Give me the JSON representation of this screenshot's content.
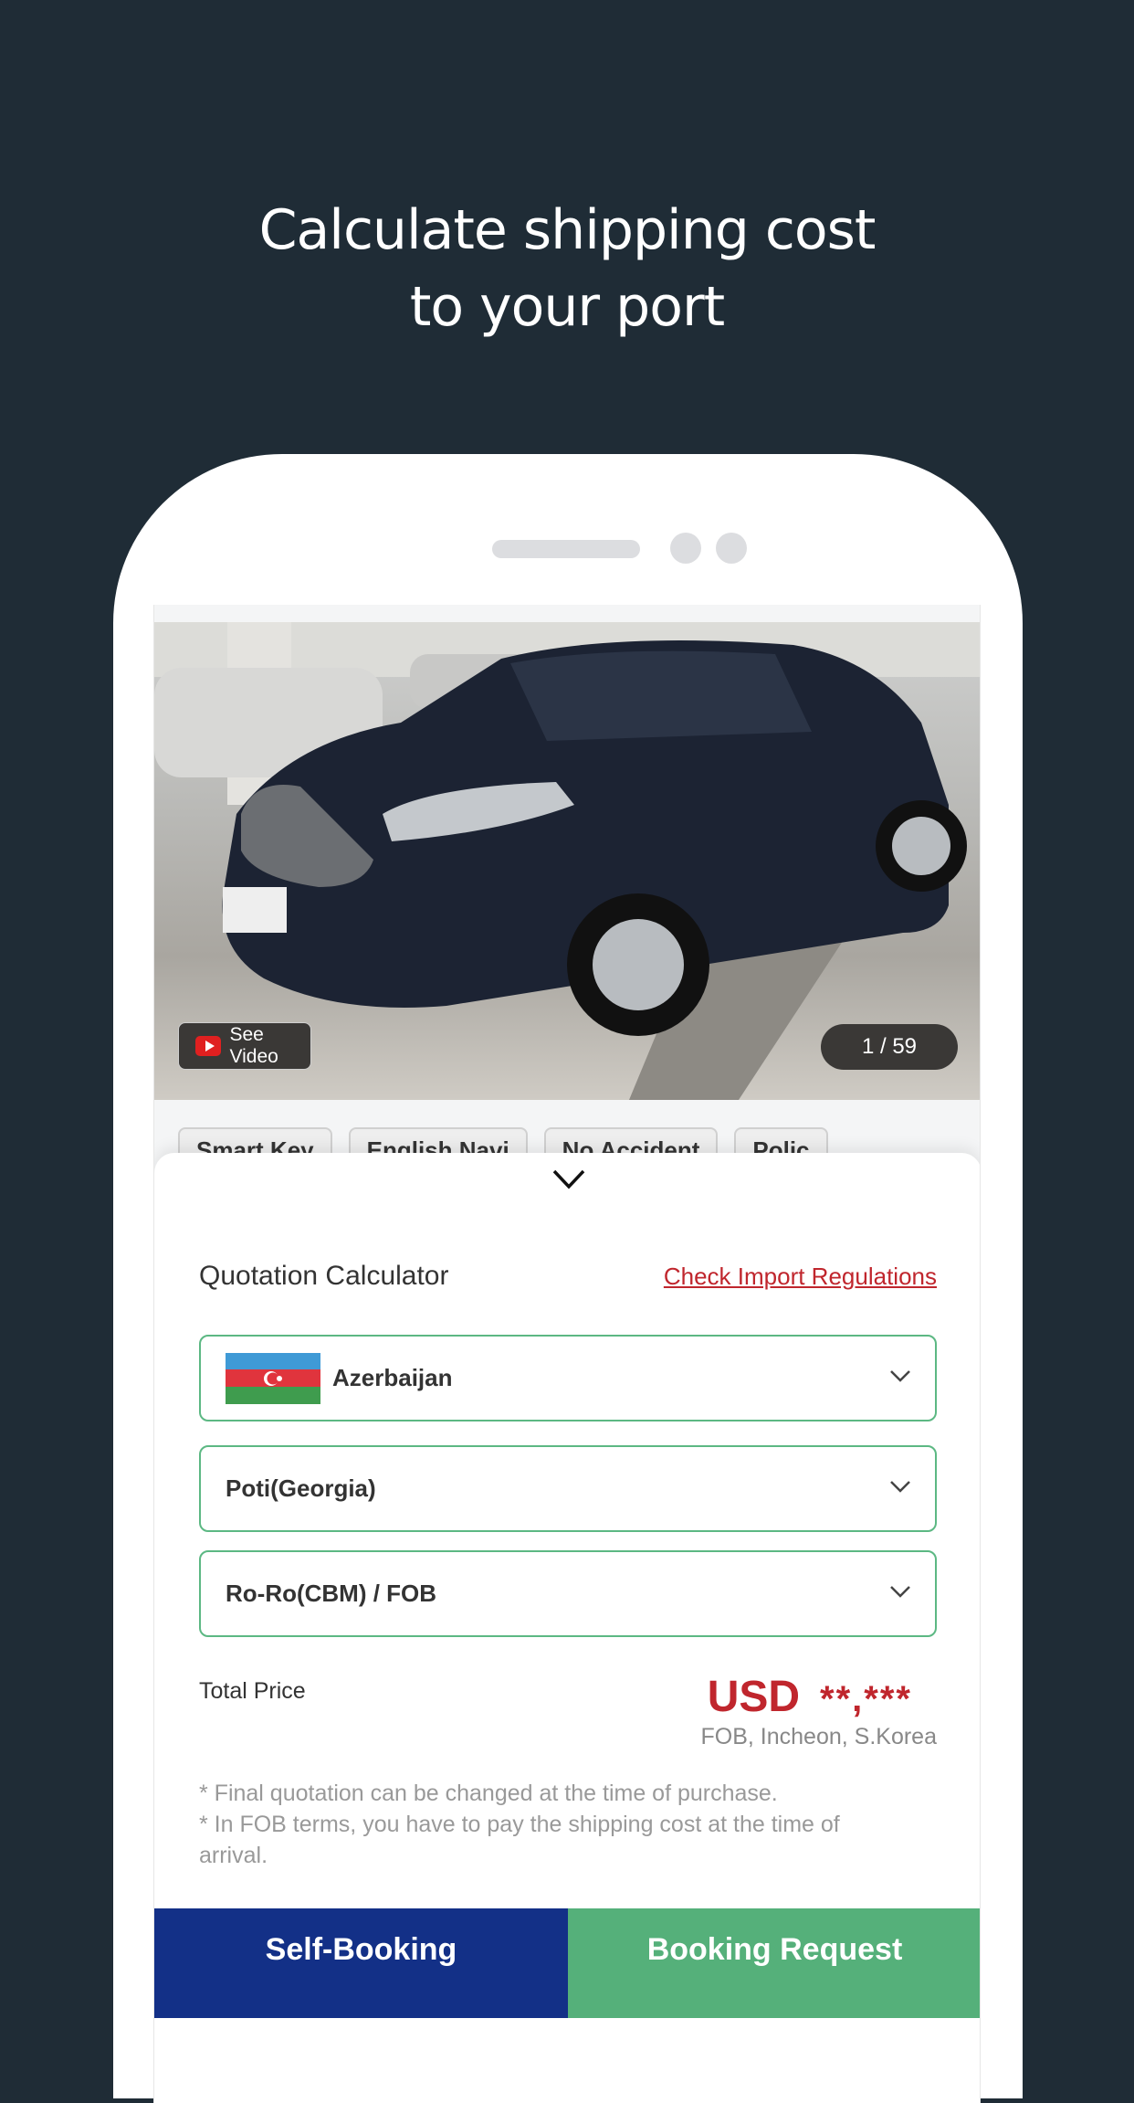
{
  "headline": {
    "line1": "Calculate shipping cost",
    "line2": "to your port"
  },
  "gallery": {
    "video_label": "See Video",
    "counter": "1 / 59",
    "icon": "youtube-play-icon"
  },
  "features": [
    "Smart Key",
    "English Navi",
    "No Accident",
    "Polic"
  ],
  "calculator": {
    "title": "Quotation Calculator",
    "link": "Check Import Regulations",
    "country": "Azerbaijan",
    "port": "Poti(Georgia)",
    "method": "Ro-Ro(CBM) / FOB",
    "total_label": "Total Price",
    "currency": "USD",
    "amount": "**,***",
    "terms": "FOB, Incheon, S.Korea",
    "notes": [
      "* Final quotation can be changed at the time of purchase.",
      "* In FOB terms, you have to pay the shipping cost at the time of arrival."
    ]
  },
  "buttons": {
    "self_booking": "Self-Booking",
    "booking_request": "Booking Request"
  },
  "colors": {
    "background": "#1f2c36",
    "accent_green": "#5cb883",
    "self_booking": "#133087",
    "booking_request": "#55b07a",
    "price_red": "#c0262d"
  }
}
